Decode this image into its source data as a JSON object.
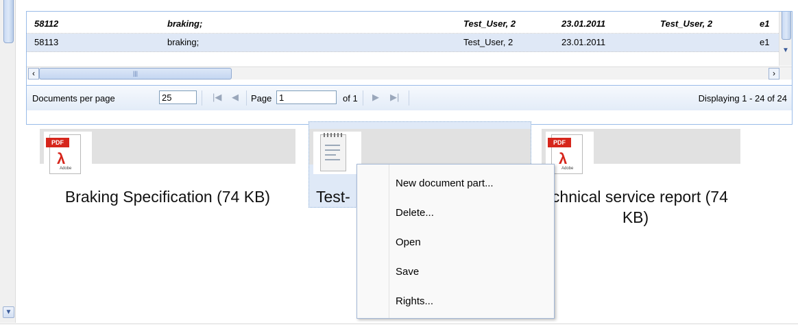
{
  "grid": {
    "rows": [
      {
        "id": "58112",
        "description": "braking;",
        "created_by": "Test_User, 2",
        "date": "23.01.2011",
        "modified_by": "Test_User, 2",
        "extra": "e1"
      },
      {
        "id": "58113",
        "description": "braking;",
        "created_by": "Test_User, 2",
        "date": "23.01.2011",
        "modified_by": "",
        "extra": "e1"
      }
    ]
  },
  "pager": {
    "per_page_label": "Documents per page",
    "per_page_value": "25",
    "page_label": "Page",
    "page_value": "1",
    "of_label": "of 1",
    "display_text": "Displaying 1 - 24 of 24"
  },
  "files": [
    {
      "label": "Braking Specification (74 KB)",
      "icon": "pdf-icon"
    },
    {
      "label": "Test-",
      "icon": "notepad-icon"
    },
    {
      "label": "echnical service report (74 KB)",
      "icon": "pdf-icon"
    }
  ],
  "context_menu": {
    "items": [
      "New document part...",
      "Delete...",
      "Open",
      "Save",
      "Rights..."
    ]
  },
  "icons": {
    "pdf_tag": "PDF",
    "adobe_label": "Adobe"
  }
}
